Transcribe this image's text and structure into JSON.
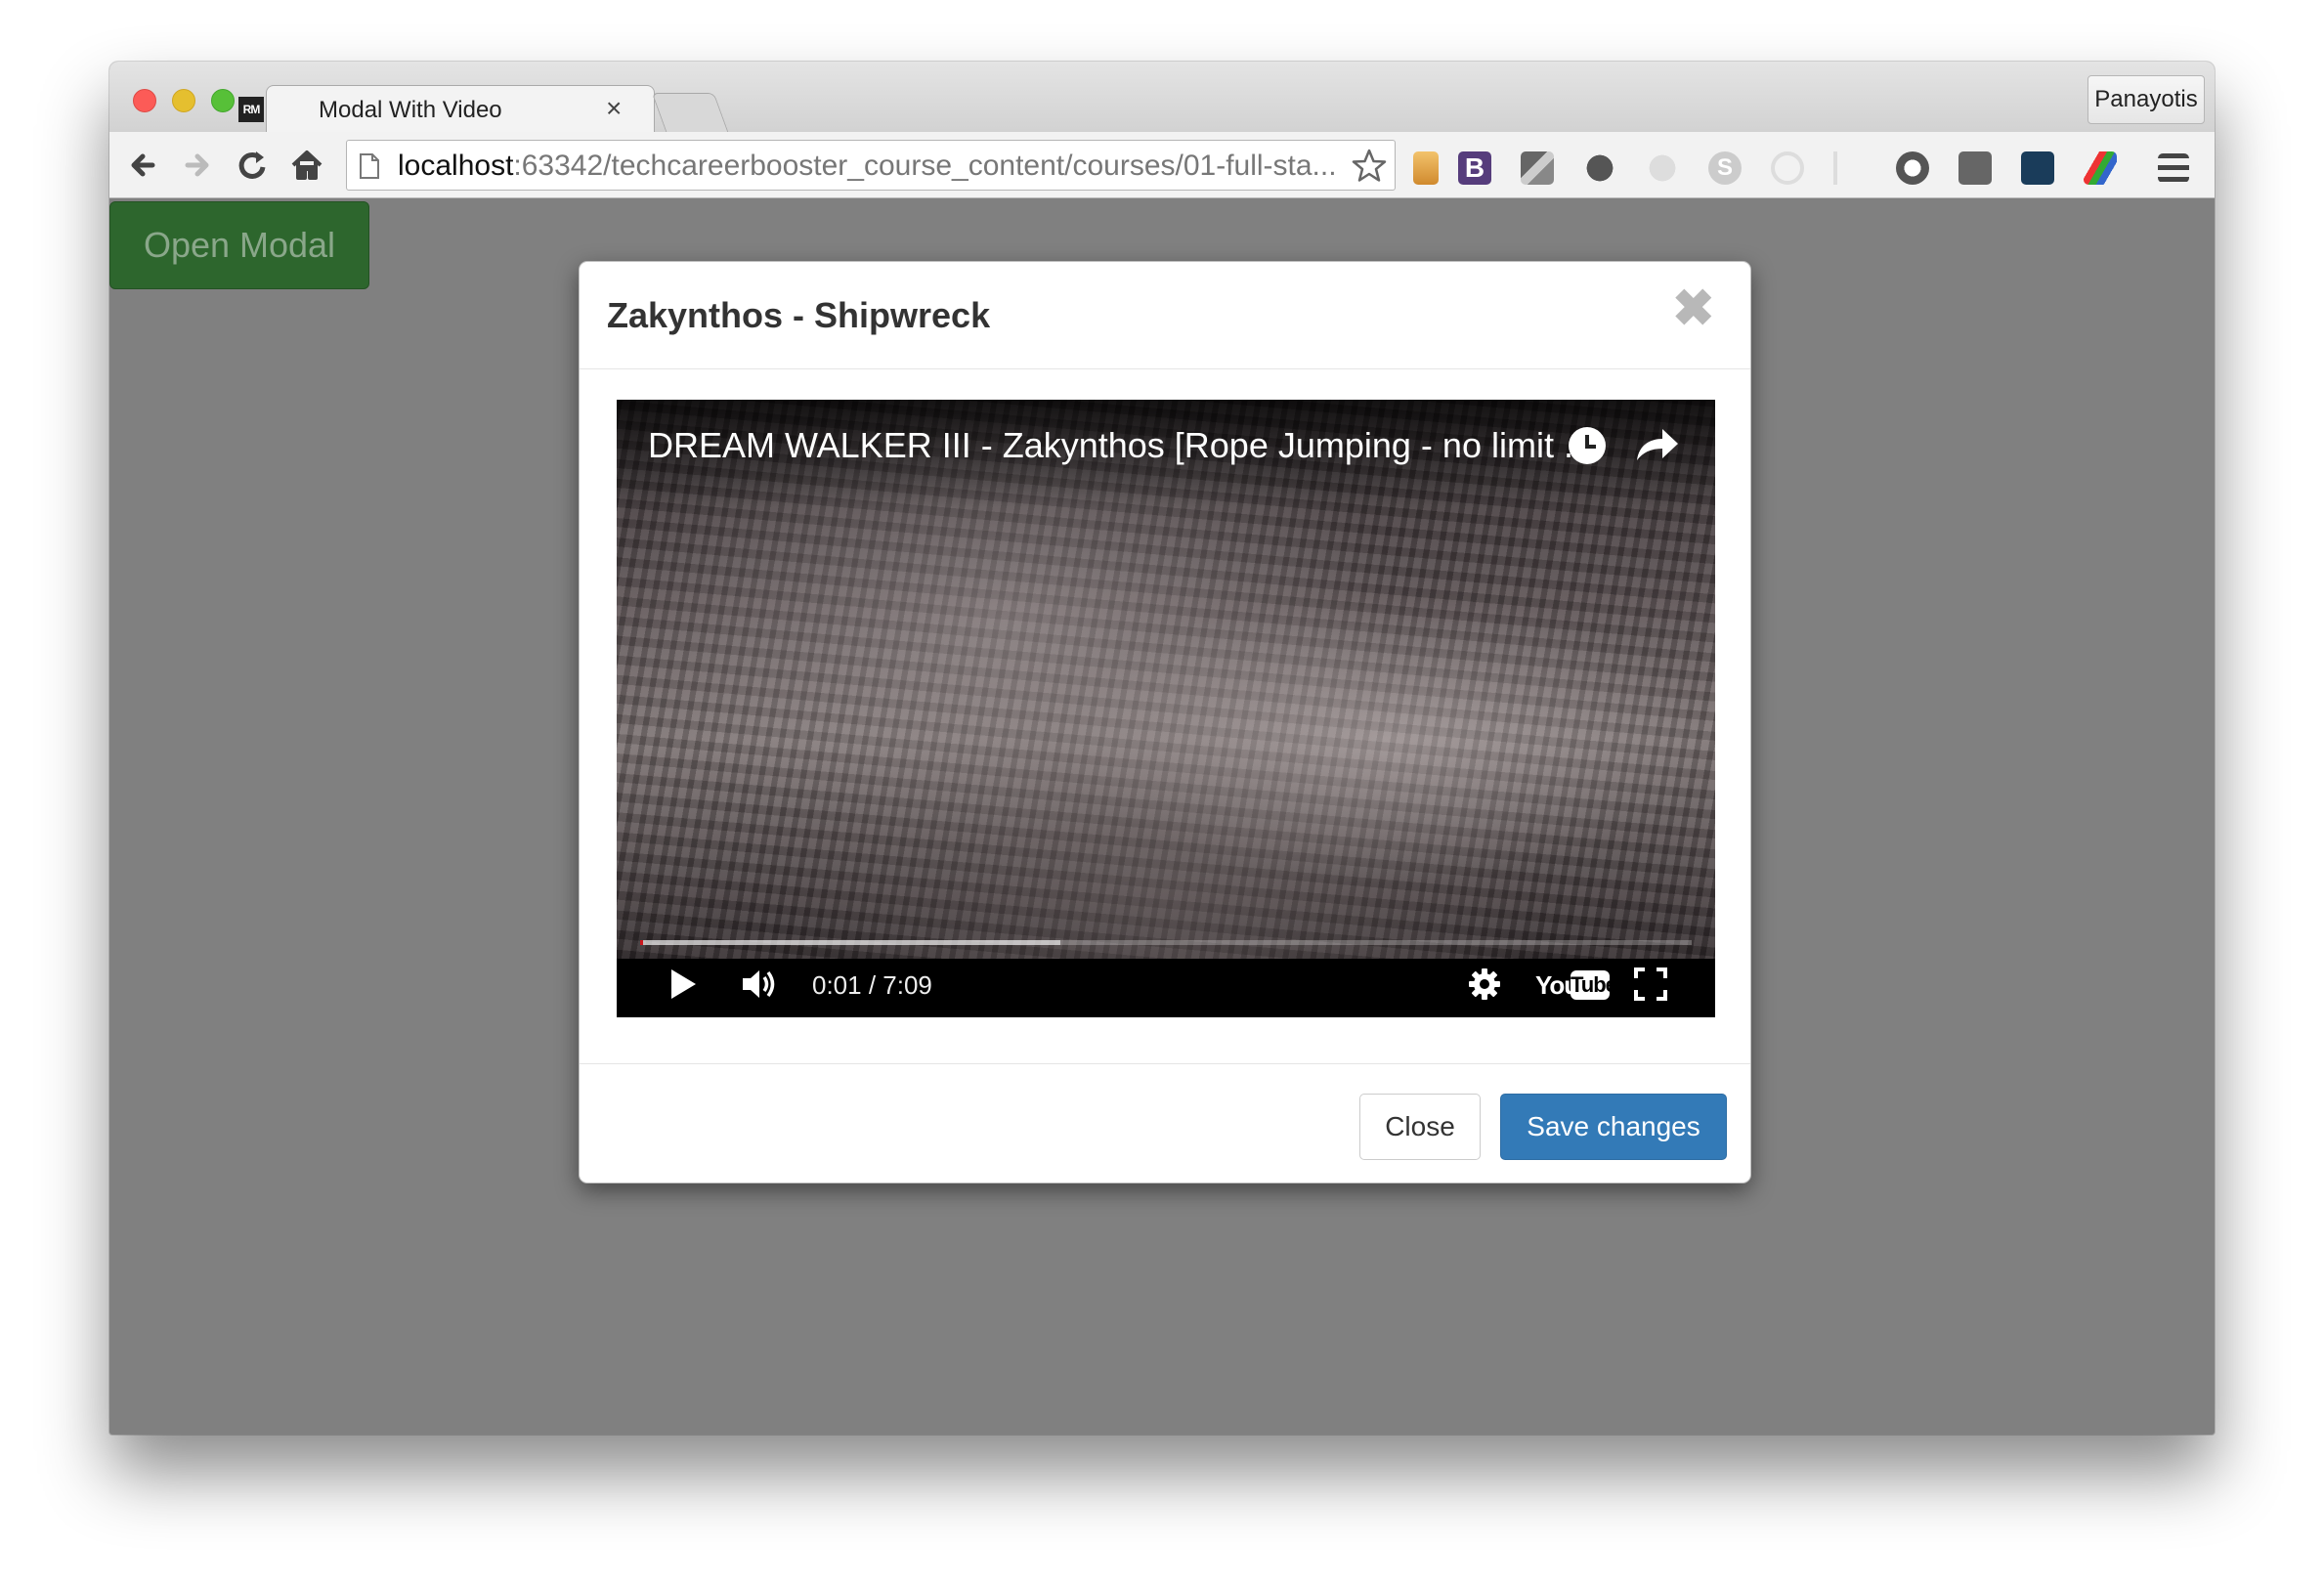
{
  "browser": {
    "tab_title": "Modal With Video",
    "tab_favicon": "RM",
    "tab_close": "×",
    "profile_name": "Panayotis",
    "url_host": "localhost",
    "url_rest": ":63342/techcareerbooster_course_content/courses/01-full-sta..."
  },
  "page": {
    "open_modal_label": "Open Modal"
  },
  "modal": {
    "title": "Zakynthos - Shipwreck",
    "close_x": "✖",
    "video": {
      "title": "DREAM WALKER III - Zakynthos [Rope Jumping - no limit ...",
      "time": "0:01 / 7:09",
      "progress_fraction": 0.0023,
      "buffered_fraction": 0.4,
      "logo_you": "You",
      "logo_tube": "Tube"
    },
    "footer": {
      "close_label": "Close",
      "save_label": "Save changes"
    }
  },
  "colors": {
    "overlay": "#808080",
    "open_modal_btn": "#2d662d",
    "primary": "#337ab7",
    "progress_red": "#cc181e"
  },
  "icons": [
    "back-icon",
    "forward-icon",
    "reload-icon",
    "home-icon",
    "page-icon",
    "bookmark-star-icon",
    "clock-icon",
    "share-icon",
    "play-icon",
    "volume-icon",
    "settings-icon",
    "youtube-logo",
    "fullscreen-icon",
    "menu-icon"
  ]
}
